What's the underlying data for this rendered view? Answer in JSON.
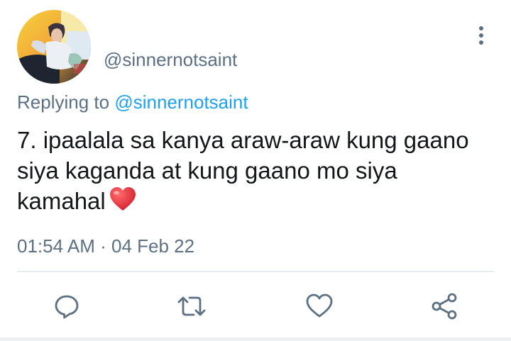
{
  "tweet": {
    "handle": "@sinnernotsaint",
    "replying_to_prefix": "Replying to",
    "replying_to_mention": "@sinnernotsaint",
    "text": "7. ipaalala sa kanya araw-araw kung gaano siya kaganda at kung gaano mo siya kamahal",
    "emoji": "red-heart-emoji",
    "time": "01:54 AM",
    "separator": "·",
    "date": "04 Feb 22"
  },
  "icons": {
    "more": "vertical-dots-icon",
    "reply": "reply-icon",
    "retweet": "retweet-icon",
    "like": "heart-icon",
    "share": "share-icon"
  },
  "colors": {
    "text": "#14171a",
    "secondary": "#5b7083",
    "mention": "#1da1f2",
    "heart": "#e0245e"
  }
}
